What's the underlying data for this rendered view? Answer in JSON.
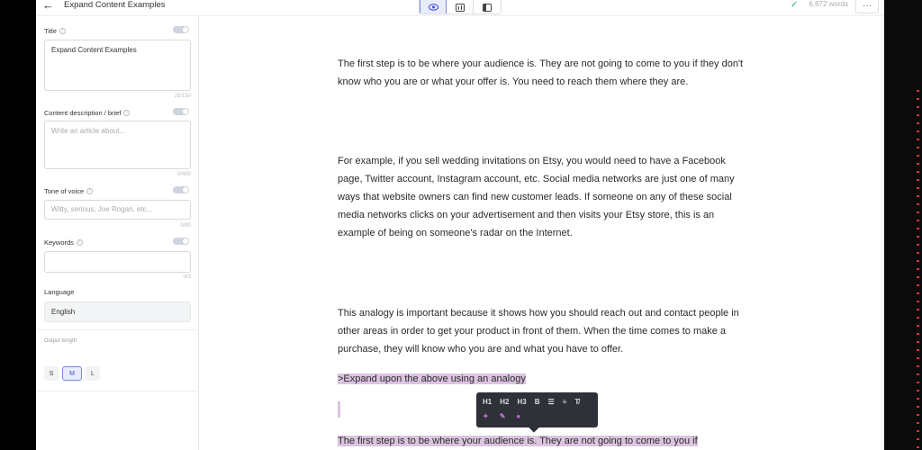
{
  "header": {
    "back_icon": "arrow-left-icon",
    "title": "Expand Content Examples",
    "view_buttons": [
      "eye-icon",
      "columns-icon",
      "sidebar-icon"
    ],
    "word_count": "6,672 words"
  },
  "sidebar": {
    "title": {
      "label": "Title",
      "value": "Expand Content Examples",
      "counter": "25/150"
    },
    "brief": {
      "label": "Content description / brief",
      "placeholder": "Write an article about...",
      "counter": "0/400"
    },
    "tone": {
      "label": "Tone of voice",
      "placeholder": "Witty, serious, Joe Rogan, etc...",
      "counter": "0/80"
    },
    "keywords": {
      "label": "Keywords",
      "value": "",
      "counter": "0/3"
    },
    "language": {
      "label": "Language",
      "value": "English"
    },
    "output_length": {
      "label": "Output length",
      "options": [
        "S",
        "M",
        "L"
      ],
      "selected": "M"
    }
  },
  "content": {
    "p1": "The first step is to be where your audience is. They are not going to come to you if they don't know who you are or what your offer is. You need to reach them where they are.",
    "p2": "For example, if you sell wedding invitations on Etsy, you would need to have a Facebook page, Twitter account, Instagram account, etc. Social media networks are just one of many ways that website owners can find new customer leads. If someone on any of these social media networks clicks on your advertisement and then visits your Etsy store, this is an example of being on someone's radar on the Internet.",
    "p3": "This analogy is important because it shows how you should reach out and contact people in other areas in order to get your product in front of them. When the time comes to make a purchase, they will know who you are and what you have to offer.",
    "command": ">Expand upon the above using an analogy",
    "p4": "The first step is to be where your audience is. They are not going to come to you if"
  },
  "format_toolbar": {
    "row1": [
      "H1",
      "H2",
      "H3",
      "B",
      "ordered-list-icon",
      "bullet-list-icon",
      "clear-format-icon"
    ],
    "row2": [
      "sparkle-icon",
      "pen-icon",
      "emoji-icon"
    ]
  },
  "colors": {
    "accent": "#3a48d6",
    "highlight": "#dcc4e0",
    "toolbar": "#2f3138"
  }
}
